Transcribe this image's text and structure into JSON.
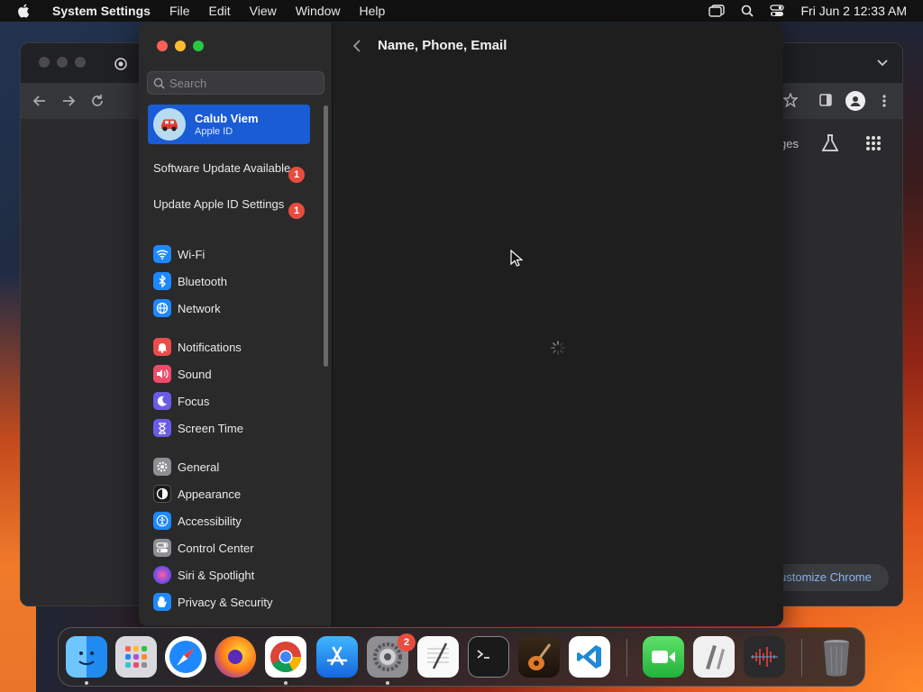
{
  "menubar": {
    "app_name": "System Settings",
    "menus": [
      "File",
      "Edit",
      "View",
      "Window",
      "Help"
    ],
    "clock": "Fri Jun 2  12:33 AM"
  },
  "chrome": {
    "customize_label": "ustomize Chrome",
    "partial_tab_text": "ges"
  },
  "settings": {
    "search_placeholder": "Search",
    "account": {
      "name": "Calub Viem",
      "subtitle": "Apple ID"
    },
    "notices": [
      {
        "label": "Software Update Available",
        "badge": "1"
      },
      {
        "label": "Update Apple ID Settings",
        "badge": "1"
      }
    ],
    "nav_groups": [
      [
        {
          "label": "Wi-Fi",
          "icon": "wifi-icon",
          "color": "#1e88ff"
        },
        {
          "label": "Bluetooth",
          "icon": "bluetooth-icon",
          "color": "#1e88ff"
        },
        {
          "label": "Network",
          "icon": "globe-icon",
          "color": "#1e88ff"
        }
      ],
      [
        {
          "label": "Notifications",
          "icon": "bell-icon",
          "color": "#ee4b4b"
        },
        {
          "label": "Sound",
          "icon": "speaker-icon",
          "color": "#ee4b6b"
        },
        {
          "label": "Focus",
          "icon": "moon-icon",
          "color": "#6b5ce7"
        },
        {
          "label": "Screen Time",
          "icon": "hourglass-icon",
          "color": "#6b5ce7"
        }
      ],
      [
        {
          "label": "General",
          "icon": "gear-icon",
          "color": "#8e8e93"
        },
        {
          "label": "Appearance",
          "icon": "appearance-icon",
          "color": "#1a1a1a"
        },
        {
          "label": "Accessibility",
          "icon": "accessibility-icon",
          "color": "#1e88ff"
        },
        {
          "label": "Control Center",
          "icon": "control-center-icon",
          "color": "#8e8e93"
        },
        {
          "label": "Siri & Spotlight",
          "icon": "siri-icon",
          "color": "#b54be0"
        },
        {
          "label": "Privacy & Security",
          "icon": "hand-icon",
          "color": "#1e88ff"
        }
      ]
    ],
    "page_title": "Name, Phone, Email"
  },
  "dock": {
    "system_settings_badge": "2",
    "apps": [
      "finder",
      "launchpad",
      "safari",
      "firefox",
      "chrome",
      "app-store",
      "system-settings",
      "textedit",
      "terminal",
      "garageband",
      "vscode",
      "facetime",
      "script-editor",
      "audio-app",
      "trash"
    ]
  }
}
